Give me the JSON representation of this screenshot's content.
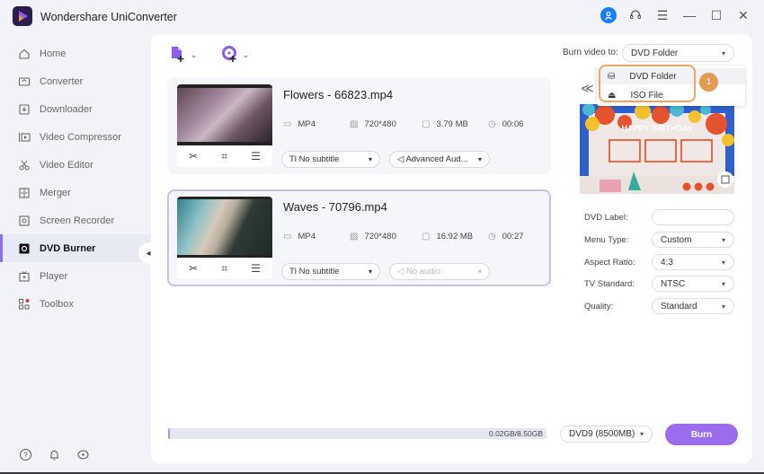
{
  "app": {
    "title": "Wondershare UniConverter"
  },
  "titlebar": {
    "icons": [
      "account-icon",
      "support-icon",
      "menu-icon",
      "minimize-icon",
      "maximize-icon",
      "close-icon"
    ]
  },
  "sidebar": {
    "items": [
      {
        "label": "Home",
        "icon": "home-icon"
      },
      {
        "label": "Converter",
        "icon": "converter-icon"
      },
      {
        "label": "Downloader",
        "icon": "downloader-icon"
      },
      {
        "label": "Video Compressor",
        "icon": "compressor-icon"
      },
      {
        "label": "Video Editor",
        "icon": "scissors-icon"
      },
      {
        "label": "Merger",
        "icon": "merger-icon"
      },
      {
        "label": "Screen Recorder",
        "icon": "screen-recorder-icon"
      },
      {
        "label": "DVD Burner",
        "icon": "dvd-icon",
        "active": true
      },
      {
        "label": "Player",
        "icon": "player-icon"
      },
      {
        "label": "Toolbox",
        "icon": "toolbox-icon"
      }
    ],
    "bottom_icons": [
      "help-icon",
      "bell-icon",
      "feedback-icon"
    ]
  },
  "toolbar": {
    "add_file": "add-file-icon",
    "add_disc": "add-disc-icon"
  },
  "burn_to": {
    "label": "Burn video to:",
    "value": "DVD Folder",
    "options": [
      "DVD Folder",
      "ISO File"
    ]
  },
  "annotation": {
    "step": "1"
  },
  "files": [
    {
      "name": "Flowers - 66823.mp4",
      "format": "MP4",
      "resolution": "720*480",
      "size": "3.79 MB",
      "duration": "00:06",
      "subtitle": "No subtitle",
      "audio": "Advanced Aud...",
      "audio_disabled": false
    },
    {
      "name": "Waves - 70796.mp4",
      "format": "MP4",
      "resolution": "720*480",
      "size": "16.92 MB",
      "duration": "00:27",
      "subtitle": "No subtitle",
      "audio": "No audio",
      "audio_disabled": true
    }
  ],
  "template_preview": {
    "title": "HAPPY BIRTHDAY"
  },
  "settings": {
    "dvd_label": {
      "label": "DVD Label:",
      "value": ""
    },
    "menu_type": {
      "label": "Menu Type:",
      "value": "Custom"
    },
    "aspect_ratio": {
      "label": "Aspect Ratio:",
      "value": "4:3"
    },
    "tv_standard": {
      "label": "TV Standard:",
      "value": "NTSC"
    },
    "quality": {
      "label": "Quality:",
      "value": "Standard"
    }
  },
  "footer": {
    "storage": "0.02GB/8.50GB",
    "storage_fraction": 0.0024,
    "disc_type": "DVD9 (8500MB)",
    "burn_label": "Burn"
  }
}
